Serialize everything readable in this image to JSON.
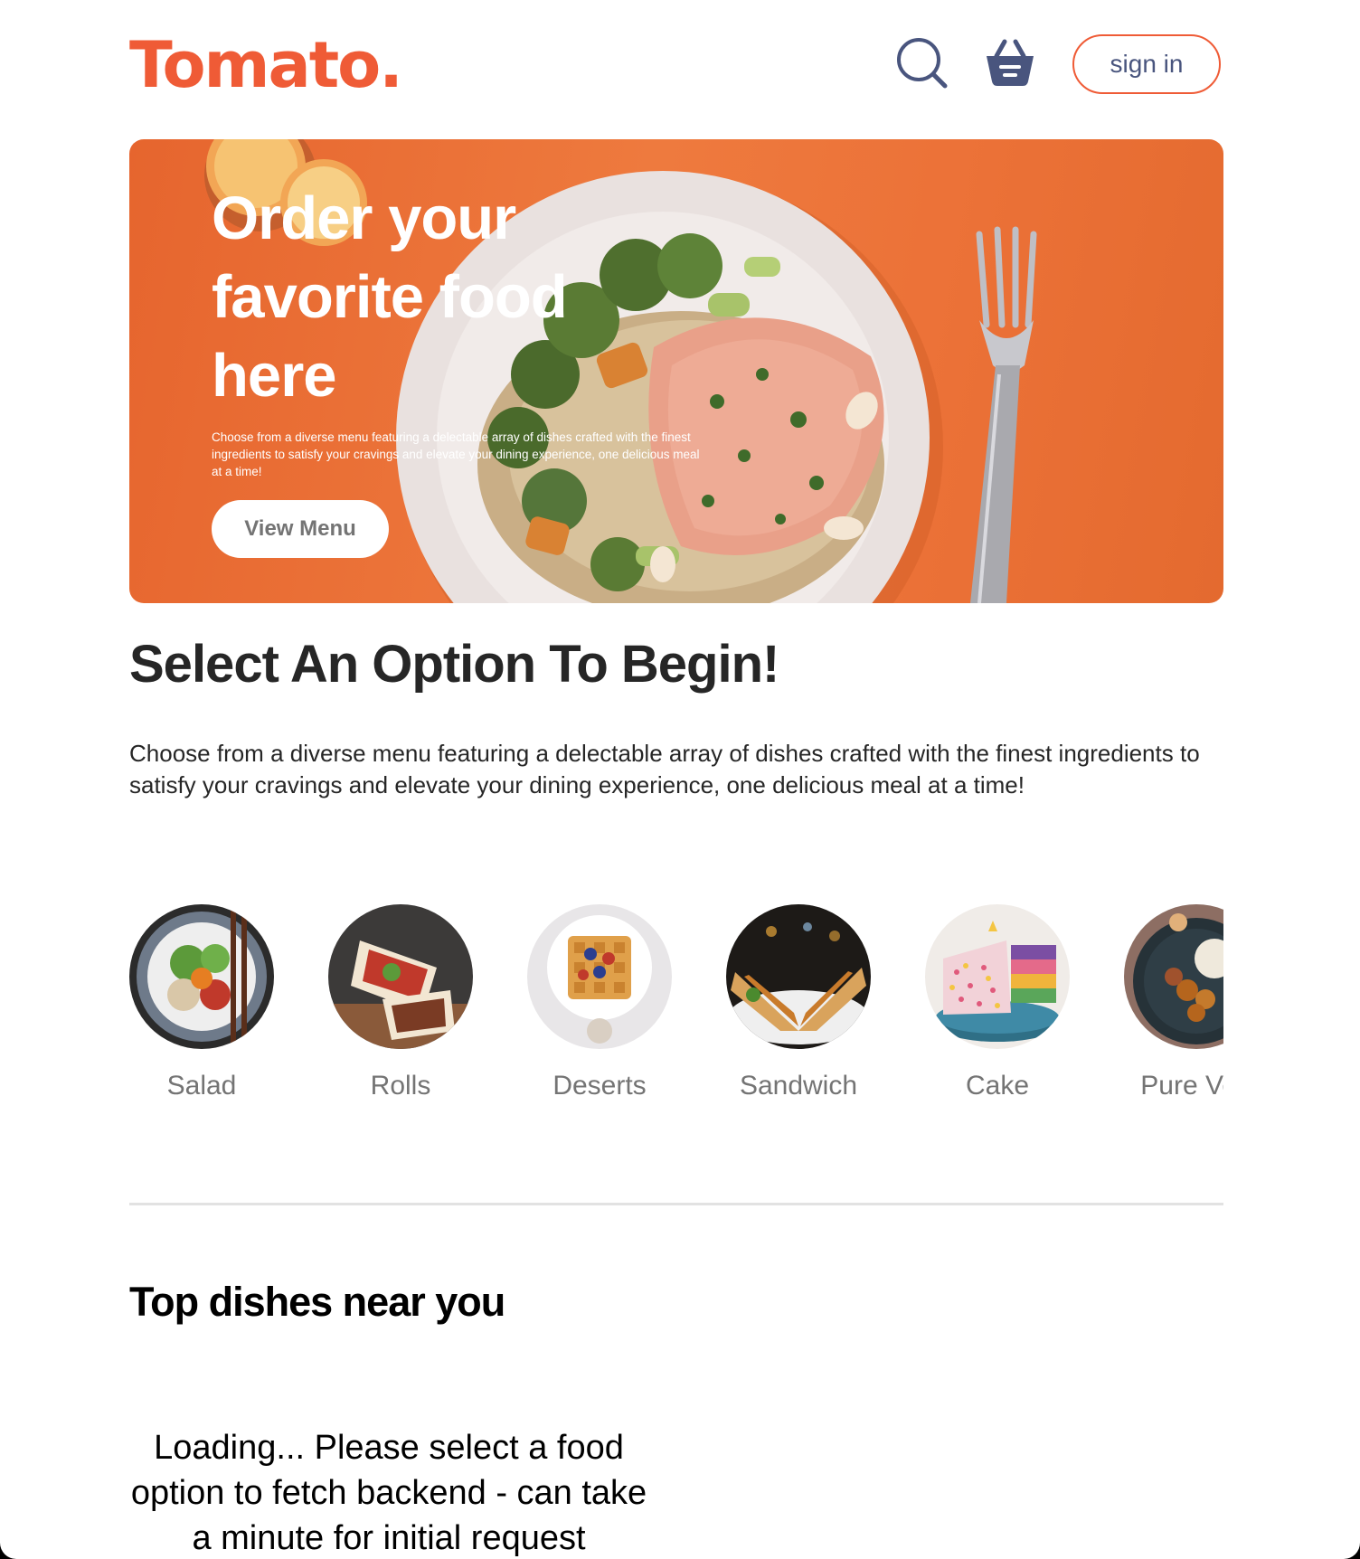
{
  "brand": {
    "logo_text": "Tomato.",
    "accent_color": "#ef5b36",
    "nav_text_color": "#49557e"
  },
  "navbar": {
    "search_icon": "search-icon",
    "basket_icon": "basket-icon",
    "signin_label": "sign in"
  },
  "hero": {
    "title": "Order your favorite food here",
    "description": "Choose from a diverse menu featuring a delectable array of dishes crafted with the finest ingredients to satisfy your cravings and elevate your dining experience, one delicious meal at a time!",
    "button_label": "View Menu"
  },
  "explore": {
    "title": "Select An Option To Begin!",
    "description": "Choose from a diverse menu featuring a delectable array of dishes crafted with the finest ingredients to satisfy your cravings and elevate your dining experience, one delicious meal at a time!",
    "items": [
      {
        "label": "Salad"
      },
      {
        "label": "Rolls"
      },
      {
        "label": "Deserts"
      },
      {
        "label": "Sandwich"
      },
      {
        "label": "Cake"
      },
      {
        "label": "Pure Veg"
      }
    ]
  },
  "top_dishes": {
    "title": "Top dishes near you",
    "loading_text": "Loading... Please select a food option to fetch backend - can take a minute for initial request"
  }
}
